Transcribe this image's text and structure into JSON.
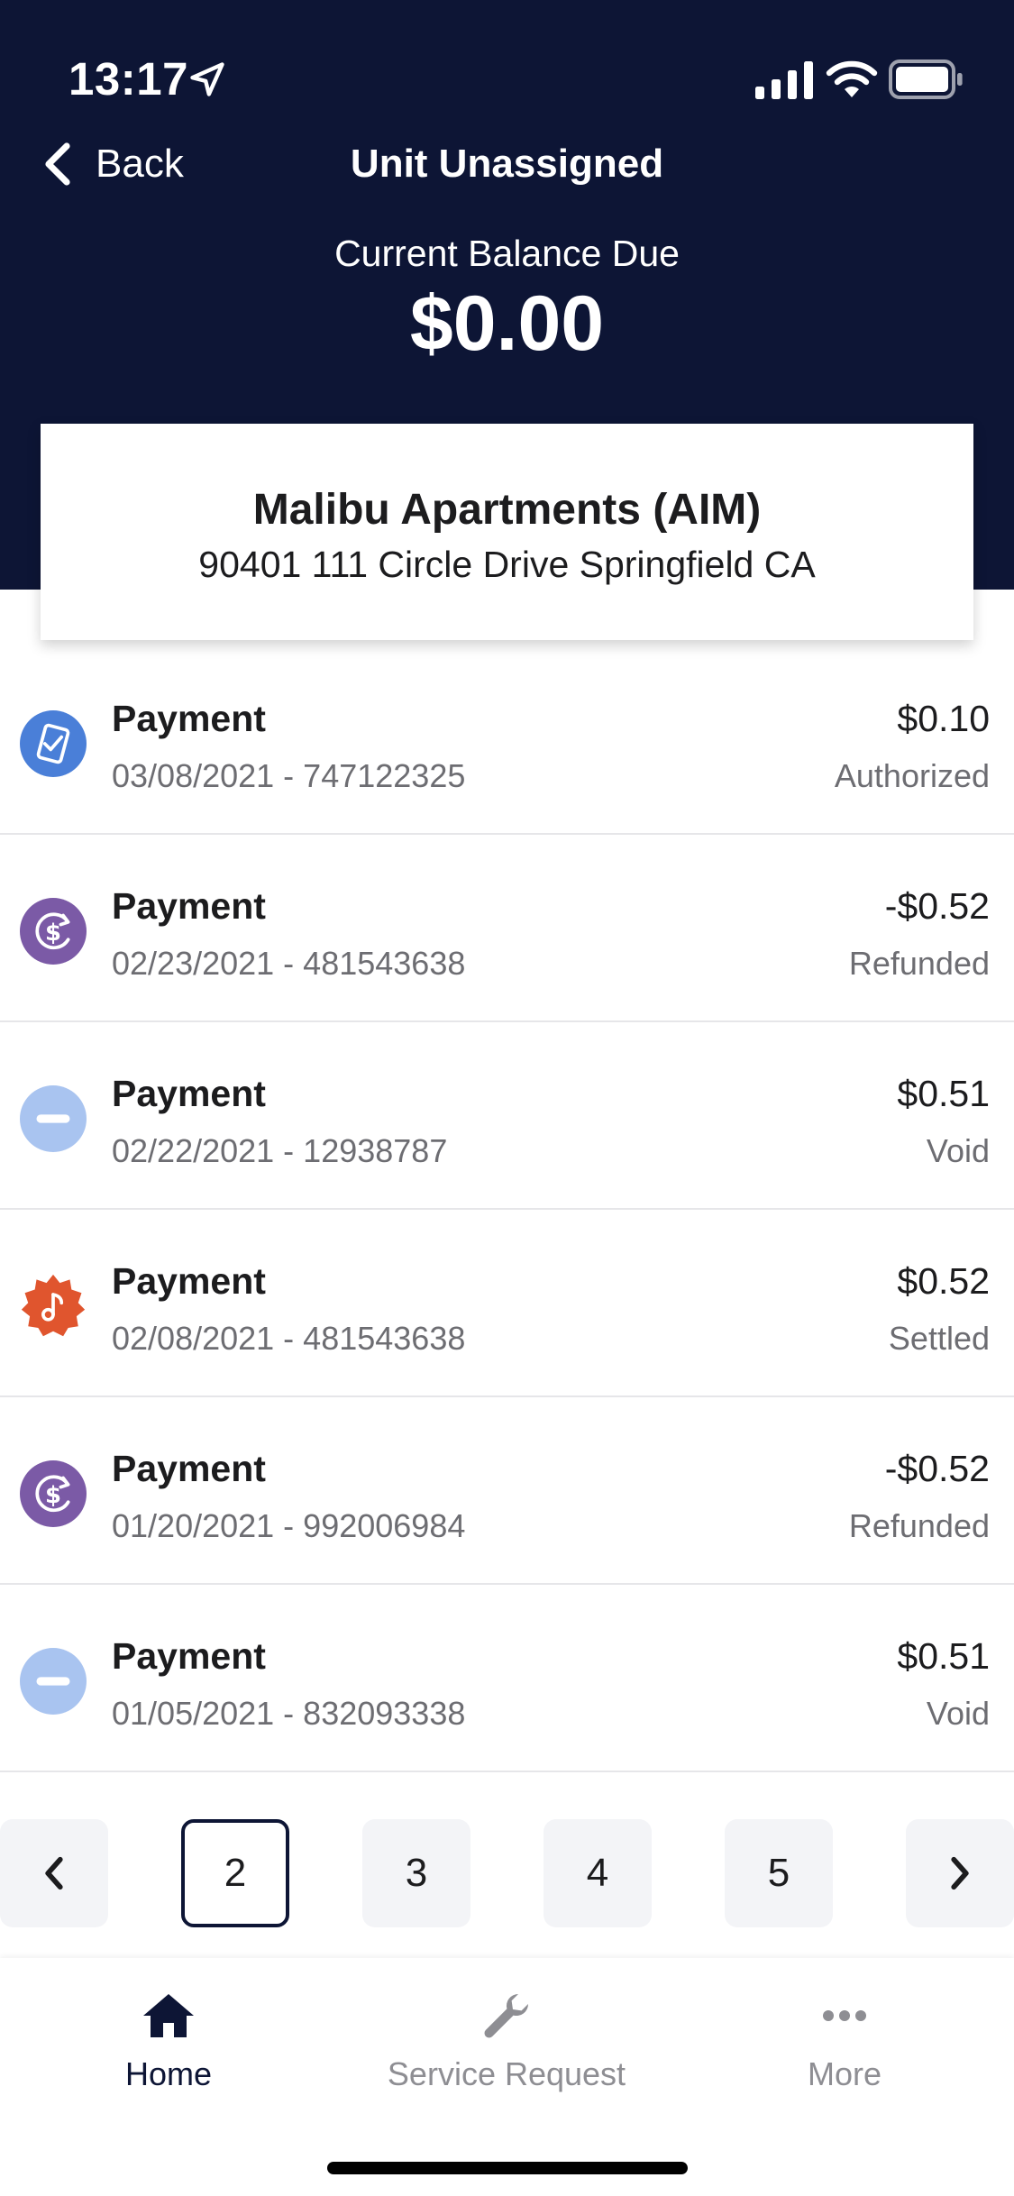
{
  "status_bar": {
    "time": "13:17"
  },
  "nav": {
    "back_label": "Back",
    "title": "Unit Unassigned"
  },
  "balance": {
    "label": "Current Balance Due",
    "amount": "$0.00"
  },
  "property": {
    "name": "Malibu Apartments (AIM)",
    "address": "90401 111 Circle Drive Springfield CA"
  },
  "transactions": [
    {
      "type": "Payment",
      "meta": "03/08/2021 - 747122325",
      "amount": "$0.10",
      "status": "Authorized",
      "icon": "mobile-check-icon",
      "color": "#4a7fd8"
    },
    {
      "type": "Payment",
      "meta": "02/23/2021 - 481543638",
      "amount": "-$0.52",
      "status": "Refunded",
      "icon": "refund-dollar-icon",
      "color": "#7b5aa6"
    },
    {
      "type": "Payment",
      "meta": "02/22/2021 - 12938787",
      "amount": "$0.51",
      "status": "Void",
      "icon": "void-minus-icon",
      "color": "#a9c4f0"
    },
    {
      "type": "Payment",
      "meta": "02/08/2021 - 481543638",
      "amount": "$0.52",
      "status": "Settled",
      "icon": "settled-badge-icon",
      "color": "#e0552e"
    },
    {
      "type": "Payment",
      "meta": "01/20/2021 - 992006984",
      "amount": "-$0.52",
      "status": "Refunded",
      "icon": "refund-dollar-icon",
      "color": "#7b5aa6"
    },
    {
      "type": "Payment",
      "meta": "01/05/2021 - 832093338",
      "amount": "$0.51",
      "status": "Void",
      "icon": "void-minus-icon",
      "color": "#a9c4f0"
    }
  ],
  "pagination": {
    "pages": [
      "2",
      "3",
      "4",
      "5"
    ],
    "current": "2"
  },
  "tab_bar": {
    "home": "Home",
    "service_request": "Service Request",
    "more": "More"
  },
  "colors": {
    "header_bg": "#0d1535",
    "active_tab": "#0d1535",
    "inactive_tab": "#8e8e93"
  }
}
